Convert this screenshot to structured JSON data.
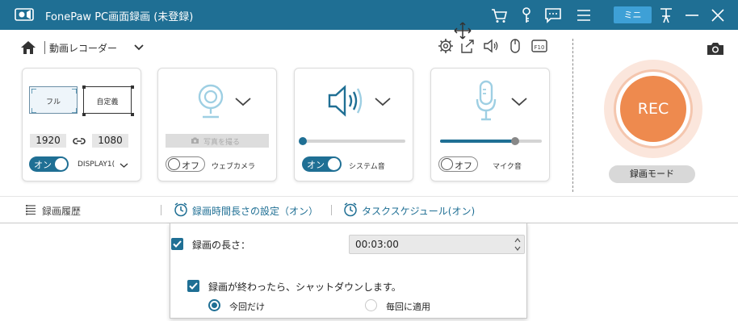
{
  "titlebar": {
    "title": "FonePaw PC画面録画 (未登録)",
    "mini_label": "ミニ",
    "icons": [
      "logo-icon",
      "cart-icon",
      "key-icon",
      "chat-icon",
      "menu-icon",
      "mini-button",
      "pin-icon",
      "minimize-icon",
      "close-icon"
    ]
  },
  "toolbar": {
    "mode_label": "動画レコーダー",
    "icons": [
      "settings-gear-icon",
      "export-icon",
      "speaker-icon",
      "mouse-icon",
      "hotkey-icon",
      "screenshot-camera-icon"
    ]
  },
  "display_panel": {
    "full_label": "フル",
    "custom_label": "自定義",
    "width": "1920",
    "height": "1080",
    "toggle_label": "オン",
    "display_name": "DISPLAY1(",
    "toggle_state": "on"
  },
  "webcam_panel": {
    "photo_button": "写真を撮る",
    "toggle_label": "オフ",
    "label": "ウェブカメラ",
    "toggle_state": "off"
  },
  "system_audio_panel": {
    "toggle_label": "オン",
    "label": "システム音",
    "toggle_state": "on",
    "volume_fraction": 0.0
  },
  "mic_panel": {
    "toggle_label": "オフ",
    "label": "マイク音",
    "toggle_state": "off",
    "volume_fraction": 0.74
  },
  "rec": {
    "button_label": "REC",
    "mode_label": "録画モード"
  },
  "bottombar": {
    "history_label": "録画履歴",
    "duration_setting_label": "録画時間長さの設定（オン）",
    "schedule_label": "タスクスケジュール(オン)"
  },
  "duration_dropdown": {
    "length_label": "録画の長さ：",
    "length_value": "00:03:00",
    "length_checked": true,
    "shutdown_label": "録画が終わったら、シャットダウンします。",
    "shutdown_checked": true,
    "options": [
      {
        "label": "今回だけ",
        "selected": true
      },
      {
        "label": "毎回に適用",
        "selected": false
      }
    ]
  },
  "colors": {
    "titlebar": "#1f6f94",
    "accent": "#1f6f94",
    "rec": "#ee8a4e",
    "mini": "#3ea0d6"
  }
}
